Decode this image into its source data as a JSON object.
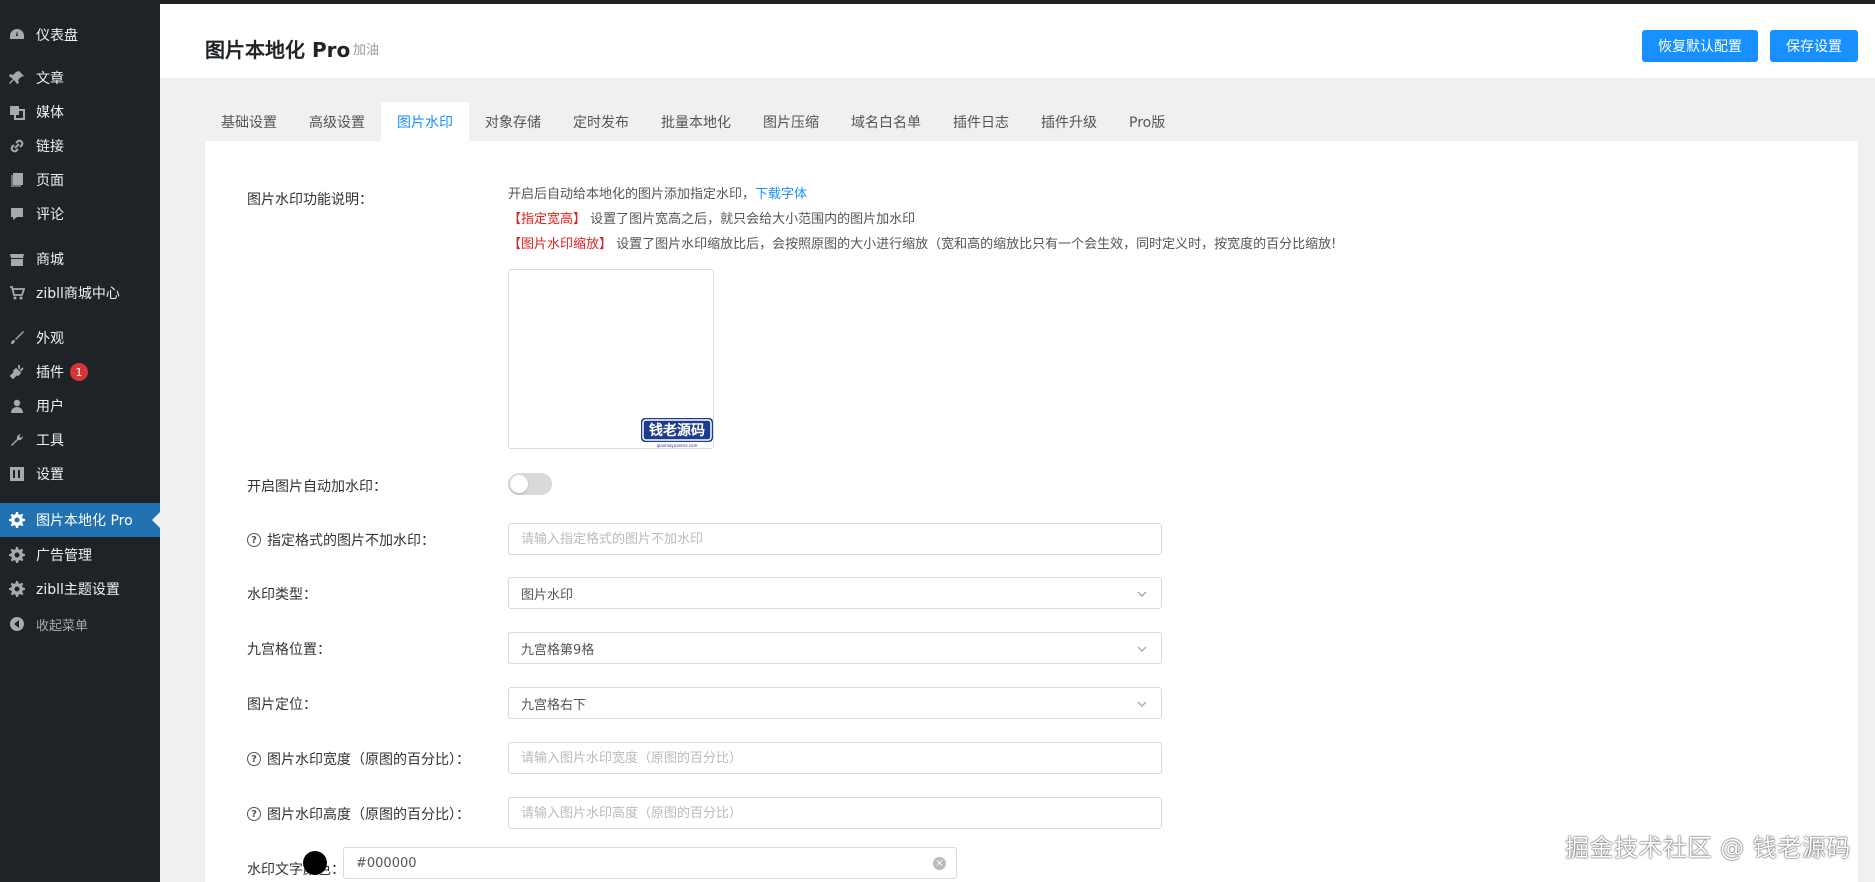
{
  "sidebar": {
    "items": [
      {
        "label": "仪表盘",
        "icon": "dashboard-icon"
      },
      {
        "label": "文章",
        "icon": "pin-icon"
      },
      {
        "label": "媒体",
        "icon": "media-icon"
      },
      {
        "label": "链接",
        "icon": "link-icon"
      },
      {
        "label": "页面",
        "icon": "page-icon"
      },
      {
        "label": "评论",
        "icon": "comment-icon"
      },
      {
        "label": "商城",
        "icon": "store-icon"
      },
      {
        "label": "zibll商城中心",
        "icon": "cart-icon"
      },
      {
        "label": "外观",
        "icon": "brush-icon"
      },
      {
        "label": "插件",
        "icon": "plugin-icon",
        "badge": "1"
      },
      {
        "label": "用户",
        "icon": "user-icon"
      },
      {
        "label": "工具",
        "icon": "wrench-icon"
      },
      {
        "label": "设置",
        "icon": "settings-icon"
      },
      {
        "label": "图片本地化 Pro",
        "icon": "gear-icon"
      },
      {
        "label": "广告管理",
        "icon": "gear-icon"
      },
      {
        "label": "zibll主题设置",
        "icon": "gear-icon"
      },
      {
        "label": "收起菜单",
        "icon": "collapse-icon"
      }
    ]
  },
  "header": {
    "title": "图片本地化 Pro",
    "subtitle": "加油",
    "reset_label": "恢复默认配置",
    "save_label": "保存设置"
  },
  "tabs": [
    {
      "label": "基础设置"
    },
    {
      "label": "高级设置"
    },
    {
      "label": "图片水印",
      "active": true
    },
    {
      "label": "对象存储"
    },
    {
      "label": "定时发布"
    },
    {
      "label": "批量本地化"
    },
    {
      "label": "图片压缩"
    },
    {
      "label": "域名白名单"
    },
    {
      "label": "插件日志"
    },
    {
      "label": "插件升级"
    },
    {
      "label": "Pro版"
    }
  ],
  "form": {
    "desc_label": "图片水印功能说明：",
    "desc_line1": "开启后自动给本地化的图片添加指定水印，",
    "desc_link": "下载字体",
    "desc_line2_tag": "【指定宽高】",
    "desc_line2": " 设置了图片宽高之后，就只会给大小范围内的图片加水印",
    "desc_line3_tag": "【图片水印缩放】",
    "desc_line3": " 设置了图片水印缩放比后，会按照原图的大小进行缩放（宽和高的缩放比只有一个会生效，同时定义时，按宽度的百分比缩放!",
    "preview_wm_text": "钱老源码",
    "preview_wm_sub": "qianlaoyuanma.com",
    "auto_label": "开启图片自动加水印：",
    "exclude_label": "指定格式的图片不加水印：",
    "exclude_placeholder": "请输入指定格式的图片不加水印",
    "type_label": "水印类型：",
    "type_value": "图片水印",
    "grid_label": "九宫格位置：",
    "grid_value": "九宫格第9格",
    "position_label": "图片定位：",
    "position_value": "九宫格右下",
    "width_label": "图片水印宽度（原图的百分比）：",
    "width_placeholder": "请输入图片水印宽度（原图的百分比）",
    "height_label": "图片水印高度（原图的百分比）：",
    "height_placeholder": "请输入图片水印高度（原图的百分比）",
    "color_label": "水印文字颜色：",
    "color_value": "#000000"
  },
  "overlay": {
    "text": "掘金技术社区 @ 钱老源码"
  },
  "colors": {
    "sidebar_bg": "#1d2327",
    "accent": "#1890ff",
    "wp_blue": "#2271b1",
    "badge": "#d63638"
  }
}
